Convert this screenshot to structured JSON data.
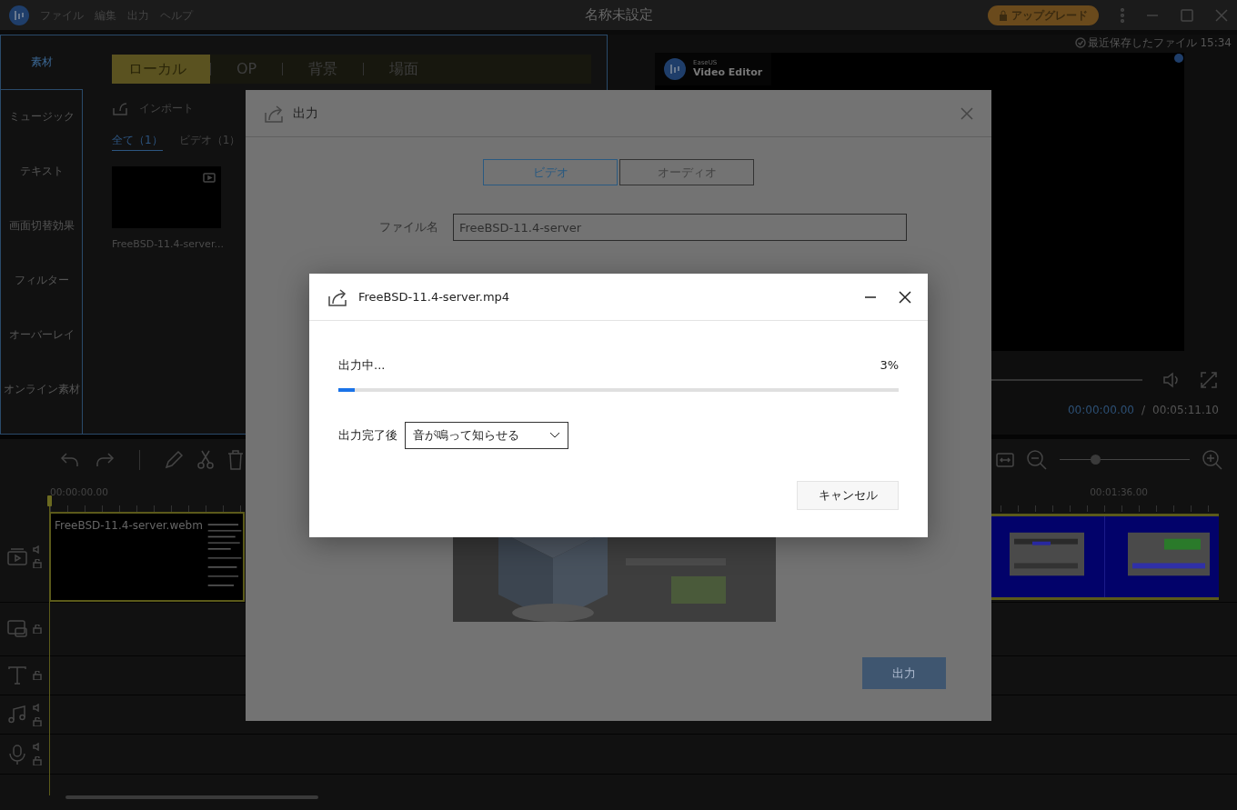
{
  "title_bar": {
    "menu": [
      "ファイル",
      "編集",
      "出力",
      "ヘルプ"
    ],
    "title": "名称未設定",
    "upgrade": "アップグレード"
  },
  "sidebar": {
    "items": [
      {
        "label": "素材",
        "selected": true
      },
      {
        "label": "ミュージック",
        "selected": false
      },
      {
        "label": "テキスト",
        "selected": false
      },
      {
        "label": "画面切替効果",
        "selected": false
      },
      {
        "label": "フィルター",
        "selected": false
      },
      {
        "label": "オーバーレイ",
        "selected": false
      },
      {
        "label": "オンライン素材",
        "selected": false
      }
    ]
  },
  "media": {
    "tabs": [
      {
        "label": "ローカル",
        "selected": true
      },
      {
        "label": "OP",
        "selected": false
      },
      {
        "label": "背景",
        "selected": false
      },
      {
        "label": "場面",
        "selected": false
      }
    ],
    "import": "インポート",
    "filters": [
      {
        "label": "全て（1）",
        "selected": true
      },
      {
        "label": "ビデオ（1）",
        "selected": false
      }
    ],
    "items": [
      {
        "caption": "FreeBSD-11.4-server..."
      }
    ]
  },
  "preview": {
    "saved": "最近保存したファイル 15:34",
    "brand_small": "EaseUS",
    "brand": "Video Editor",
    "current_time": "00:00:00.00",
    "separator": "/",
    "total_time": "00:05:11.10"
  },
  "timeline": {
    "zoom": {
      "level": 0.27
    },
    "ruler": [
      "00:00:00.00",
      "00:01:36.00"
    ],
    "tracks": [
      {
        "kind": "video",
        "clip": "FreeBSD-11.4-server.webm"
      },
      {
        "kind": "pip"
      },
      {
        "kind": "text"
      },
      {
        "kind": "music"
      },
      {
        "kind": "voice"
      }
    ]
  },
  "export_dialog": {
    "title": "出力",
    "tabs": [
      {
        "label": "ビデオ",
        "selected": true
      },
      {
        "label": "オーディオ",
        "selected": false
      }
    ],
    "file_name_label": "ファイル名",
    "file_name": "FreeBSD-11.4-server",
    "export_button": "出力"
  },
  "progress_dialog": {
    "title": "FreeBSD-11.4-server.mp4",
    "status": "出力中...",
    "percent": "3%",
    "level": 0.03,
    "after_label": "出力完了後",
    "after_value": "音が鳴って知らせる",
    "cancel": "キャンセル"
  }
}
